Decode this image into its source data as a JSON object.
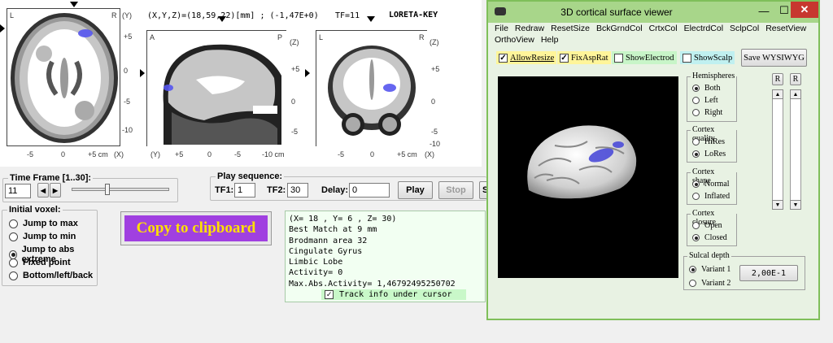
{
  "mri": {
    "coords_text": "(X,Y,Z)=(18,59,22)[mm] ; (-1,47E+0)",
    "tf_text": "TF=11",
    "app_label": "LORETA-KEY",
    "axial": {
      "left": "L",
      "right": "R",
      "right_axis": "(Y)",
      "yticks": [
        "+5",
        "0",
        "-5",
        "-10"
      ],
      "xticks": [
        "-5",
        "0",
        "+5 cm",
        "(X)"
      ]
    },
    "sagittal": {
      "left": "A",
      "right": "P",
      "right_axis": "(Z)",
      "yticks": [
        "+5",
        "0",
        "-5"
      ],
      "xticks": [
        "(Y)",
        "+5",
        "0",
        "-5",
        "-10 cm"
      ]
    },
    "coronal": {
      "left": "L",
      "right": "R",
      "right_axis": "(Z)",
      "yticks": [
        "+5",
        "0",
        "-5",
        "-10"
      ],
      "xticks": [
        "-5",
        "0",
        "+5 cm",
        "(X)"
      ]
    }
  },
  "time_frame": {
    "label": "Time Frame [1..30]:",
    "value": "11",
    "slider_fraction": 0.35
  },
  "play": {
    "label": "Play sequence:",
    "tf1_label": "TF1:",
    "tf1_value": "1",
    "tf2_label": "TF2:",
    "tf2_value": "30",
    "delay_label": "Delay:",
    "delay_value": "0",
    "play_btn": "Play",
    "stop_btn": "Stop",
    "cut_btn": "S"
  },
  "initial_voxel": {
    "label": "Initial voxel:",
    "options": [
      "Jump to max",
      "Jump to min",
      "Jump to abs extreme",
      "Fixed point",
      "Bottom/left/back"
    ],
    "selected_index": 2
  },
  "copy_button": "Copy to clipboard",
  "info": {
    "lines": [
      "(X= 18 , Y= 6 , Z= 30)",
      "Best Match at 9 mm",
      "Brodmann area 32",
      "Cingulate Gyrus",
      "Limbic Lobe",
      "Activity= 0",
      "Max.Abs.Activity= 1,46792495250702"
    ],
    "track_label": "Track info under cursor",
    "track_checked": true
  },
  "viewer": {
    "title": "3D cortical surface viewer",
    "menu": [
      "File",
      "Redraw",
      "ResetSize",
      "BckGrndCol",
      "CrtxCol",
      "ElectrdCol",
      "SclpCol",
      "ResetView",
      "OrthoView",
      "Help"
    ],
    "checks": [
      {
        "label": "AllowResize",
        "checked": true,
        "bg": "#fff59a"
      },
      {
        "label": "FixAspRat",
        "checked": true,
        "bg": "#fff59a"
      },
      {
        "label": "ShowElectrod",
        "checked": false,
        "bg": "#c8f5c8"
      },
      {
        "label": "ShowScalp",
        "checked": false,
        "bg": "#c0f0f0"
      }
    ],
    "save_btn": "Save WYSIWYG",
    "hemispheres": {
      "title": "Hemispheres",
      "options": [
        "Both",
        "Left",
        "Right"
      ],
      "selected": 0
    },
    "quality": {
      "title": "Cortex quality",
      "options": [
        "HiRes",
        "LoRes"
      ],
      "selected": 1
    },
    "shape": {
      "title": "Cortex shape",
      "options": [
        "Normal",
        "Inflated"
      ],
      "selected": 0
    },
    "closure": {
      "title": "Cortex closure",
      "options": [
        "Open",
        "Closed"
      ],
      "selected": 1
    },
    "sulcal": {
      "title": "Sulcal depth",
      "options": [
        "Variant 1",
        "Variant 2"
      ],
      "selected": 0,
      "value_btn": "2,00E-1"
    },
    "r_labels": [
      "R",
      "R"
    ]
  }
}
